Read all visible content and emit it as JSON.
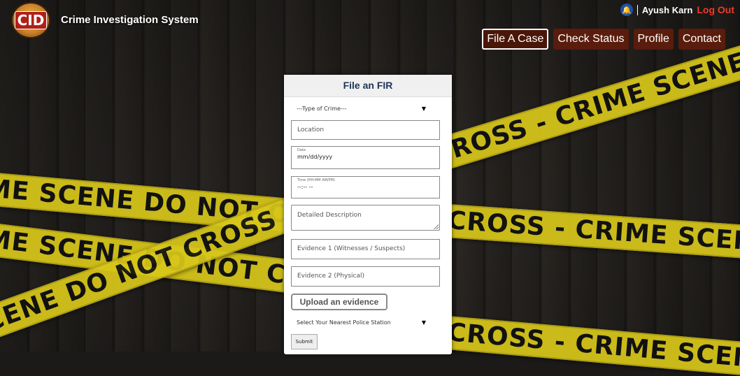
{
  "app": {
    "title": "Crime Investigation System",
    "logo_text": "CID"
  },
  "user": {
    "name": "Ayush Karn",
    "logout_label": "Log Out"
  },
  "nav": [
    {
      "label": "File A Case",
      "active": true
    },
    {
      "label": "Check Status"
    },
    {
      "label": "Profile"
    },
    {
      "label": "Contact"
    }
  ],
  "tape_text": {
    "t1": "CROSS - CRIME SCENE DO NOT CROSS - CRIME SCENE DO N",
    "t2": "ME SCENE DO NOT CROSS - CRIME SCENE DO NOT CROSS",
    "t3": "CROSS - CRIME SCENE DO NOT CROSS - CRIME SCENE",
    "t4": "ME SCENE DO NOT CROSS - CRIM",
    "t5": "CENE DO NOT CROSS - CRIME SCENE DO",
    "t6": "CROSS - CRIME SCENE DO"
  },
  "form": {
    "title": "File an FIR",
    "crime_type_placeholder": "---Type of Crime---",
    "location_placeholder": "Location",
    "date_label": "Date",
    "date_value": "mm/dd/yyyy",
    "time_label": "Time (HH:MM AM/PM)",
    "time_value": "--:-- --",
    "description_placeholder": "Detailed Description",
    "evidence1_placeholder": "Evidence 1 (Witnesses / Suspects)",
    "evidence2_placeholder": "Evidence 2 (Physical)",
    "upload_label": "Upload an evidence",
    "station_placeholder": "Select Your Nearest Police Station",
    "submit_label": "Submit"
  },
  "colors": {
    "nav_bg": "#5a1c0c",
    "logout": "#f03a2a",
    "tape": "#d9c81a",
    "form_title": "#1d3557"
  }
}
